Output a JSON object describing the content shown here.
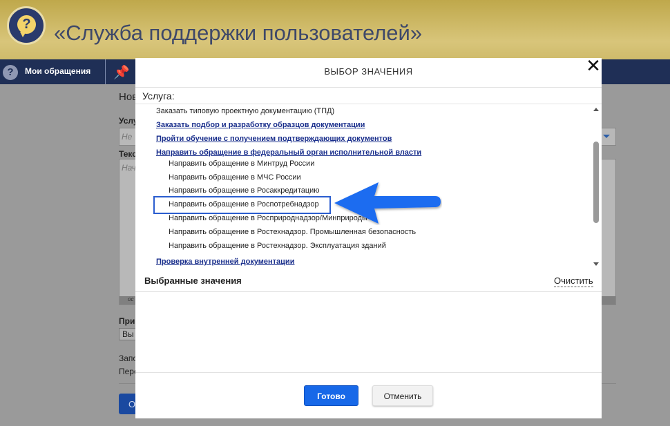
{
  "header": {
    "site_title": "«Служба поддержки пользователей»",
    "logo_glyph": "?"
  },
  "navbar": {
    "my_requests_label": "Мои обращения",
    "nav_icon_glyph": "?"
  },
  "background_page": {
    "title": "Нов",
    "service_label": "Услу",
    "service_placeholder": "Не",
    "text_label": "Текс",
    "text_placeholder": "Нач",
    "textarea_footer": "ос",
    "attach_label": "При",
    "attach_button": "Вы",
    "line1": "Запо",
    "line2": "Пере",
    "submit_label": "О"
  },
  "modal": {
    "title": "ВЫБОР ЗНАЧЕНИЯ",
    "close_glyph": "✕",
    "service_label": "Услуга:",
    "items": [
      {
        "label": "Заказать типовую проектную документацию (ТПД)",
        "link": false,
        "level": 0
      },
      {
        "label": "Заказать подбор и разработку образцов документации",
        "link": true,
        "level": 0
      },
      {
        "label": "Пройти обучение с получением подтверждающих документов",
        "link": true,
        "level": 0
      },
      {
        "label": "Направить обращение в федеральный орган исполнительной власти",
        "link": true,
        "level": 0
      },
      {
        "label": "Направить обращение в Минтруд России",
        "link": false,
        "level": 1
      },
      {
        "label": "Направить обращение в МЧС России",
        "link": false,
        "level": 1
      },
      {
        "label": "Направить обращение в Росаккредитацию",
        "link": false,
        "level": 1
      },
      {
        "label": "Направить обращение в Роспотребнадзор",
        "link": false,
        "level": 1,
        "highlighted": true
      },
      {
        "label": "Направить обращение в Росприроднадзор/Минприроды",
        "link": false,
        "level": 1
      },
      {
        "label": "Направить обращение в Ростехнадзор. Промышленная безопасность",
        "link": false,
        "level": 1
      },
      {
        "label": "Направить обращение в Ростехнадзор. Эксплуатация зданий",
        "link": false,
        "level": 1
      },
      {
        "label": "Проверка внутренней документации",
        "link": true,
        "level": 0
      }
    ],
    "selected_title": "Выбранные значения",
    "clear_label": "Очистить",
    "done_label": "Готово",
    "cancel_label": "Отменить"
  },
  "colors": {
    "header_gold": "#d8c57a",
    "navbar": "#1f2f56",
    "link": "#1a2f8c",
    "primary_button": "#1768e8",
    "annotation_arrow": "#1f6cf0"
  }
}
